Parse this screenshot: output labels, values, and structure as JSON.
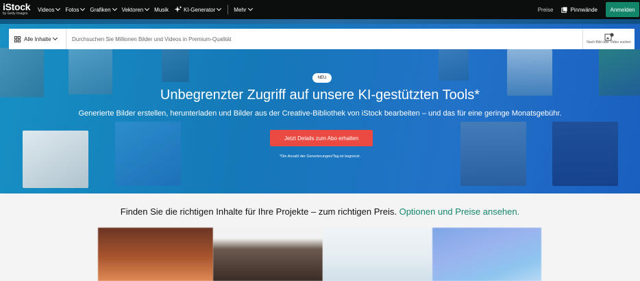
{
  "logo": {
    "name": "iStock",
    "tagline": "by Getty Images"
  },
  "nav": {
    "items": [
      {
        "label": "Videos",
        "dropdown": true
      },
      {
        "label": "Fotos",
        "dropdown": true
      },
      {
        "label": "Grafiken",
        "dropdown": true
      },
      {
        "label": "Vektoren",
        "dropdown": true
      },
      {
        "label": "Musik",
        "dropdown": false
      }
    ],
    "ai": {
      "label": "KI-Generator",
      "icon": "sparkle-icon"
    },
    "more": "Mehr",
    "pricing": "Preise",
    "boards": "Pinnwände",
    "signin": "Anmelden"
  },
  "search": {
    "scope": "Alle Inhalte",
    "placeholder": "Durchsuchen Sie Millionen Bilder und Videos in Premium-Qualität",
    "visual_label": "Nach Bild oder Video suchen"
  },
  "hero": {
    "badge": "NEU",
    "title": "Unbegrenzter Zugriff auf unsere KI-gestützten Tools*",
    "subtitle": "Generierte Bilder erstellen, herunterladen und Bilder aus der Creative-Bibliothek von iStock bearbeiten – und das für eine geringe Monatsgebühr.",
    "cta": "Jetzt Details zum Abo erhalten",
    "disclaimer": "*Die Anzahl der Generierungen/Tag ist begrenzt."
  },
  "pricing_promo": {
    "text": "Finden Sie die richtigen Inhalte für Ihre Projekte – zum richtigen Preis.",
    "link": "Optionen und Preise ansehen."
  },
  "colors": {
    "nav_bg": "#0c0d0d",
    "signin": "#13866a",
    "cta": "#eb4a42",
    "link": "#13866a"
  }
}
